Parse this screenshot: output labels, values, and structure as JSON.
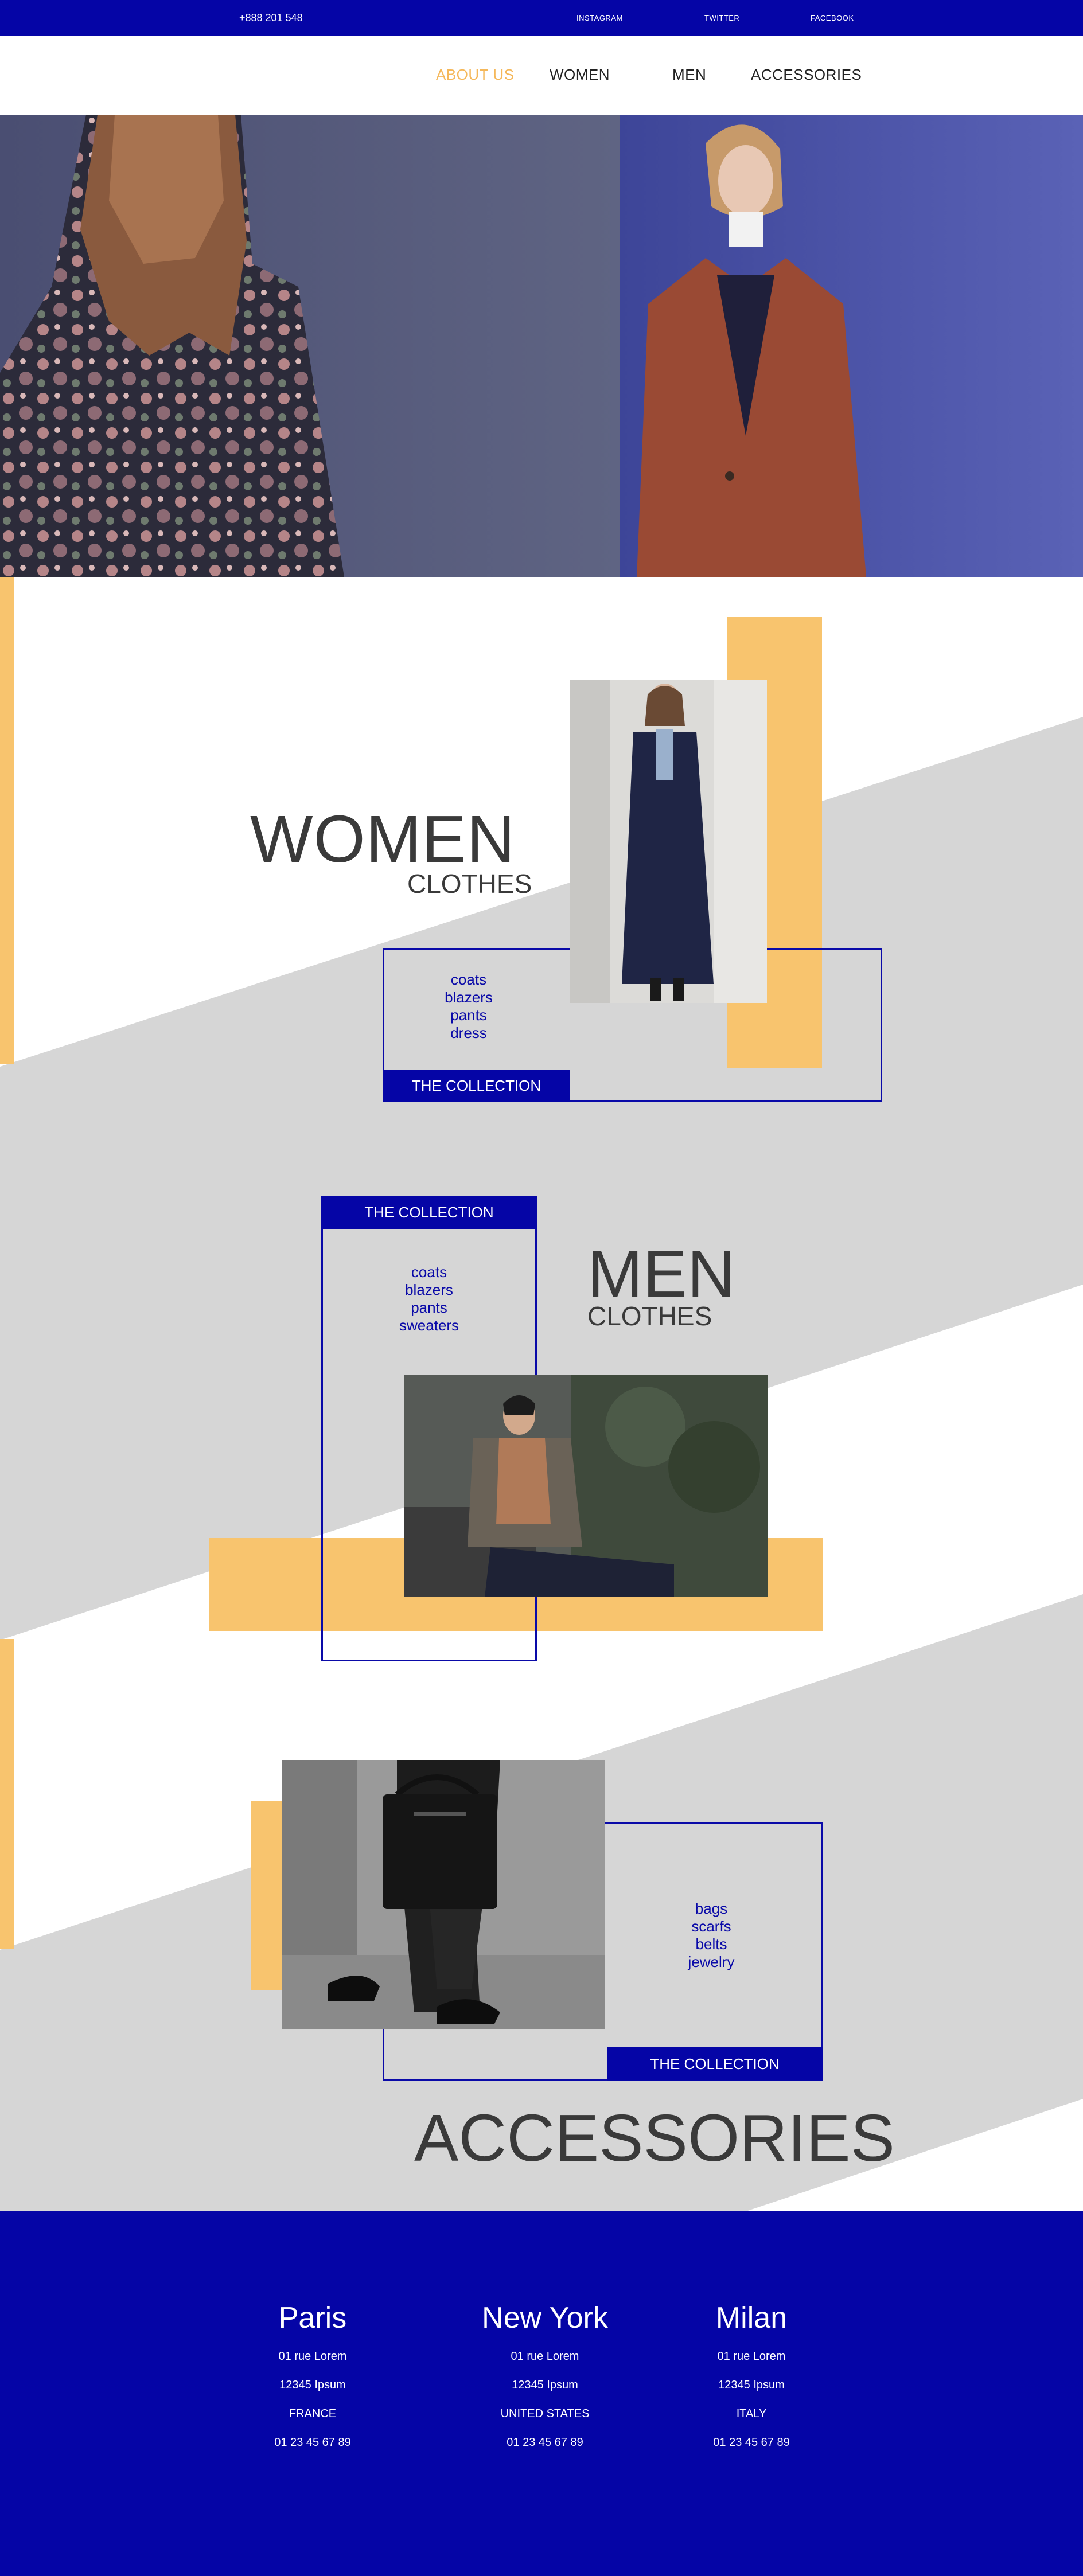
{
  "topbar": {
    "phone": "+888 201 548",
    "social": [
      "INSTAGRAM",
      "TWITTER",
      "FACEBOOK"
    ]
  },
  "nav": {
    "items": [
      {
        "label": "ABOUT US",
        "active": true
      },
      {
        "label": "WOMEN",
        "active": false
      },
      {
        "label": "MEN",
        "active": false
      },
      {
        "label": "ACCESSORIES",
        "active": false
      }
    ]
  },
  "women": {
    "title": "WOMEN",
    "subtitle": "CLOTHES",
    "items": [
      "coats",
      "blazers",
      "pants",
      "dress"
    ],
    "cta": "THE COLLECTION"
  },
  "men": {
    "title": "MEN",
    "subtitle": "CLOTHES",
    "items": [
      "coats",
      "blazers",
      "pants",
      "sweaters"
    ],
    "cta": "THE COLLECTION"
  },
  "accessories": {
    "title": "ACCESSORIES",
    "items": [
      "bags",
      "scarfs",
      "belts",
      "jewelry"
    ],
    "cta": "THE COLLECTION"
  },
  "footer": {
    "cities": [
      {
        "name": "Paris",
        "street": "01 rue Lorem",
        "zip": "12345 Ipsum",
        "country": "FRANCE",
        "phone": "01 23 45 67 89"
      },
      {
        "name": "New York",
        "street": "01 rue Lorem",
        "zip": "12345 Ipsum",
        "country": "UNITED STATES",
        "phone": "01 23 45 67 89"
      },
      {
        "name": "Milan",
        "street": "01 rue Lorem",
        "zip": "12345 Ipsum",
        "country": "ITALY",
        "phone": "01 23 45 67 89"
      }
    ]
  },
  "colors": {
    "brand_blue": "#0505a6",
    "accent_yellow": "#f8c46e",
    "band_grey": "#d6d6d6",
    "active_nav": "#f5b85a"
  }
}
